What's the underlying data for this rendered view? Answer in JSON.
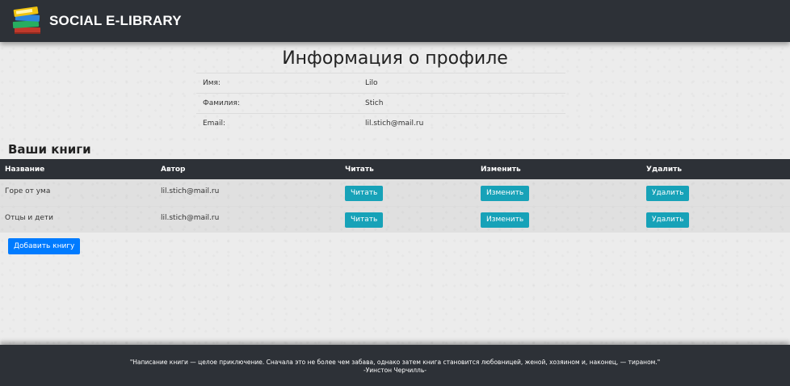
{
  "navbar": {
    "brand": "SOCIAL E-LIBRARY",
    "logo_icon": "books-stack-icon"
  },
  "profile": {
    "title": "Информация о профиле",
    "rows": [
      {
        "label": "Имя:",
        "value": "Lilo"
      },
      {
        "label": "Фамилия:",
        "value": "Stich"
      },
      {
        "label": "Email:",
        "value": "lil.stich@mail.ru"
      }
    ]
  },
  "books": {
    "section_title": "Ваши книги",
    "headers": [
      "Название",
      "Автор",
      "Читать",
      "Изменить",
      "Удалить"
    ],
    "rows": [
      {
        "title": "Горе от ума",
        "author": "lil.stich@mail.ru",
        "read": "Читать",
        "edit": "Изменить",
        "delete": "Удалить"
      },
      {
        "title": "Отцы и дети",
        "author": "lil.stich@mail.ru",
        "read": "Читать",
        "edit": "Изменить",
        "delete": "Удалить"
      }
    ],
    "add_button": "Добавить книгу"
  },
  "footer": {
    "quote": "\"Написание книги — целое приключение. Сначала это не более чем забава, однако затем книга становится любовницей, женой, хозяином и, наконец, — тираном.\"",
    "author": "-Уинстон Черчилль-"
  },
  "colors": {
    "navbar_bg": "#2d3137",
    "info_button": "#17a2b8",
    "primary_button": "#007bff"
  }
}
